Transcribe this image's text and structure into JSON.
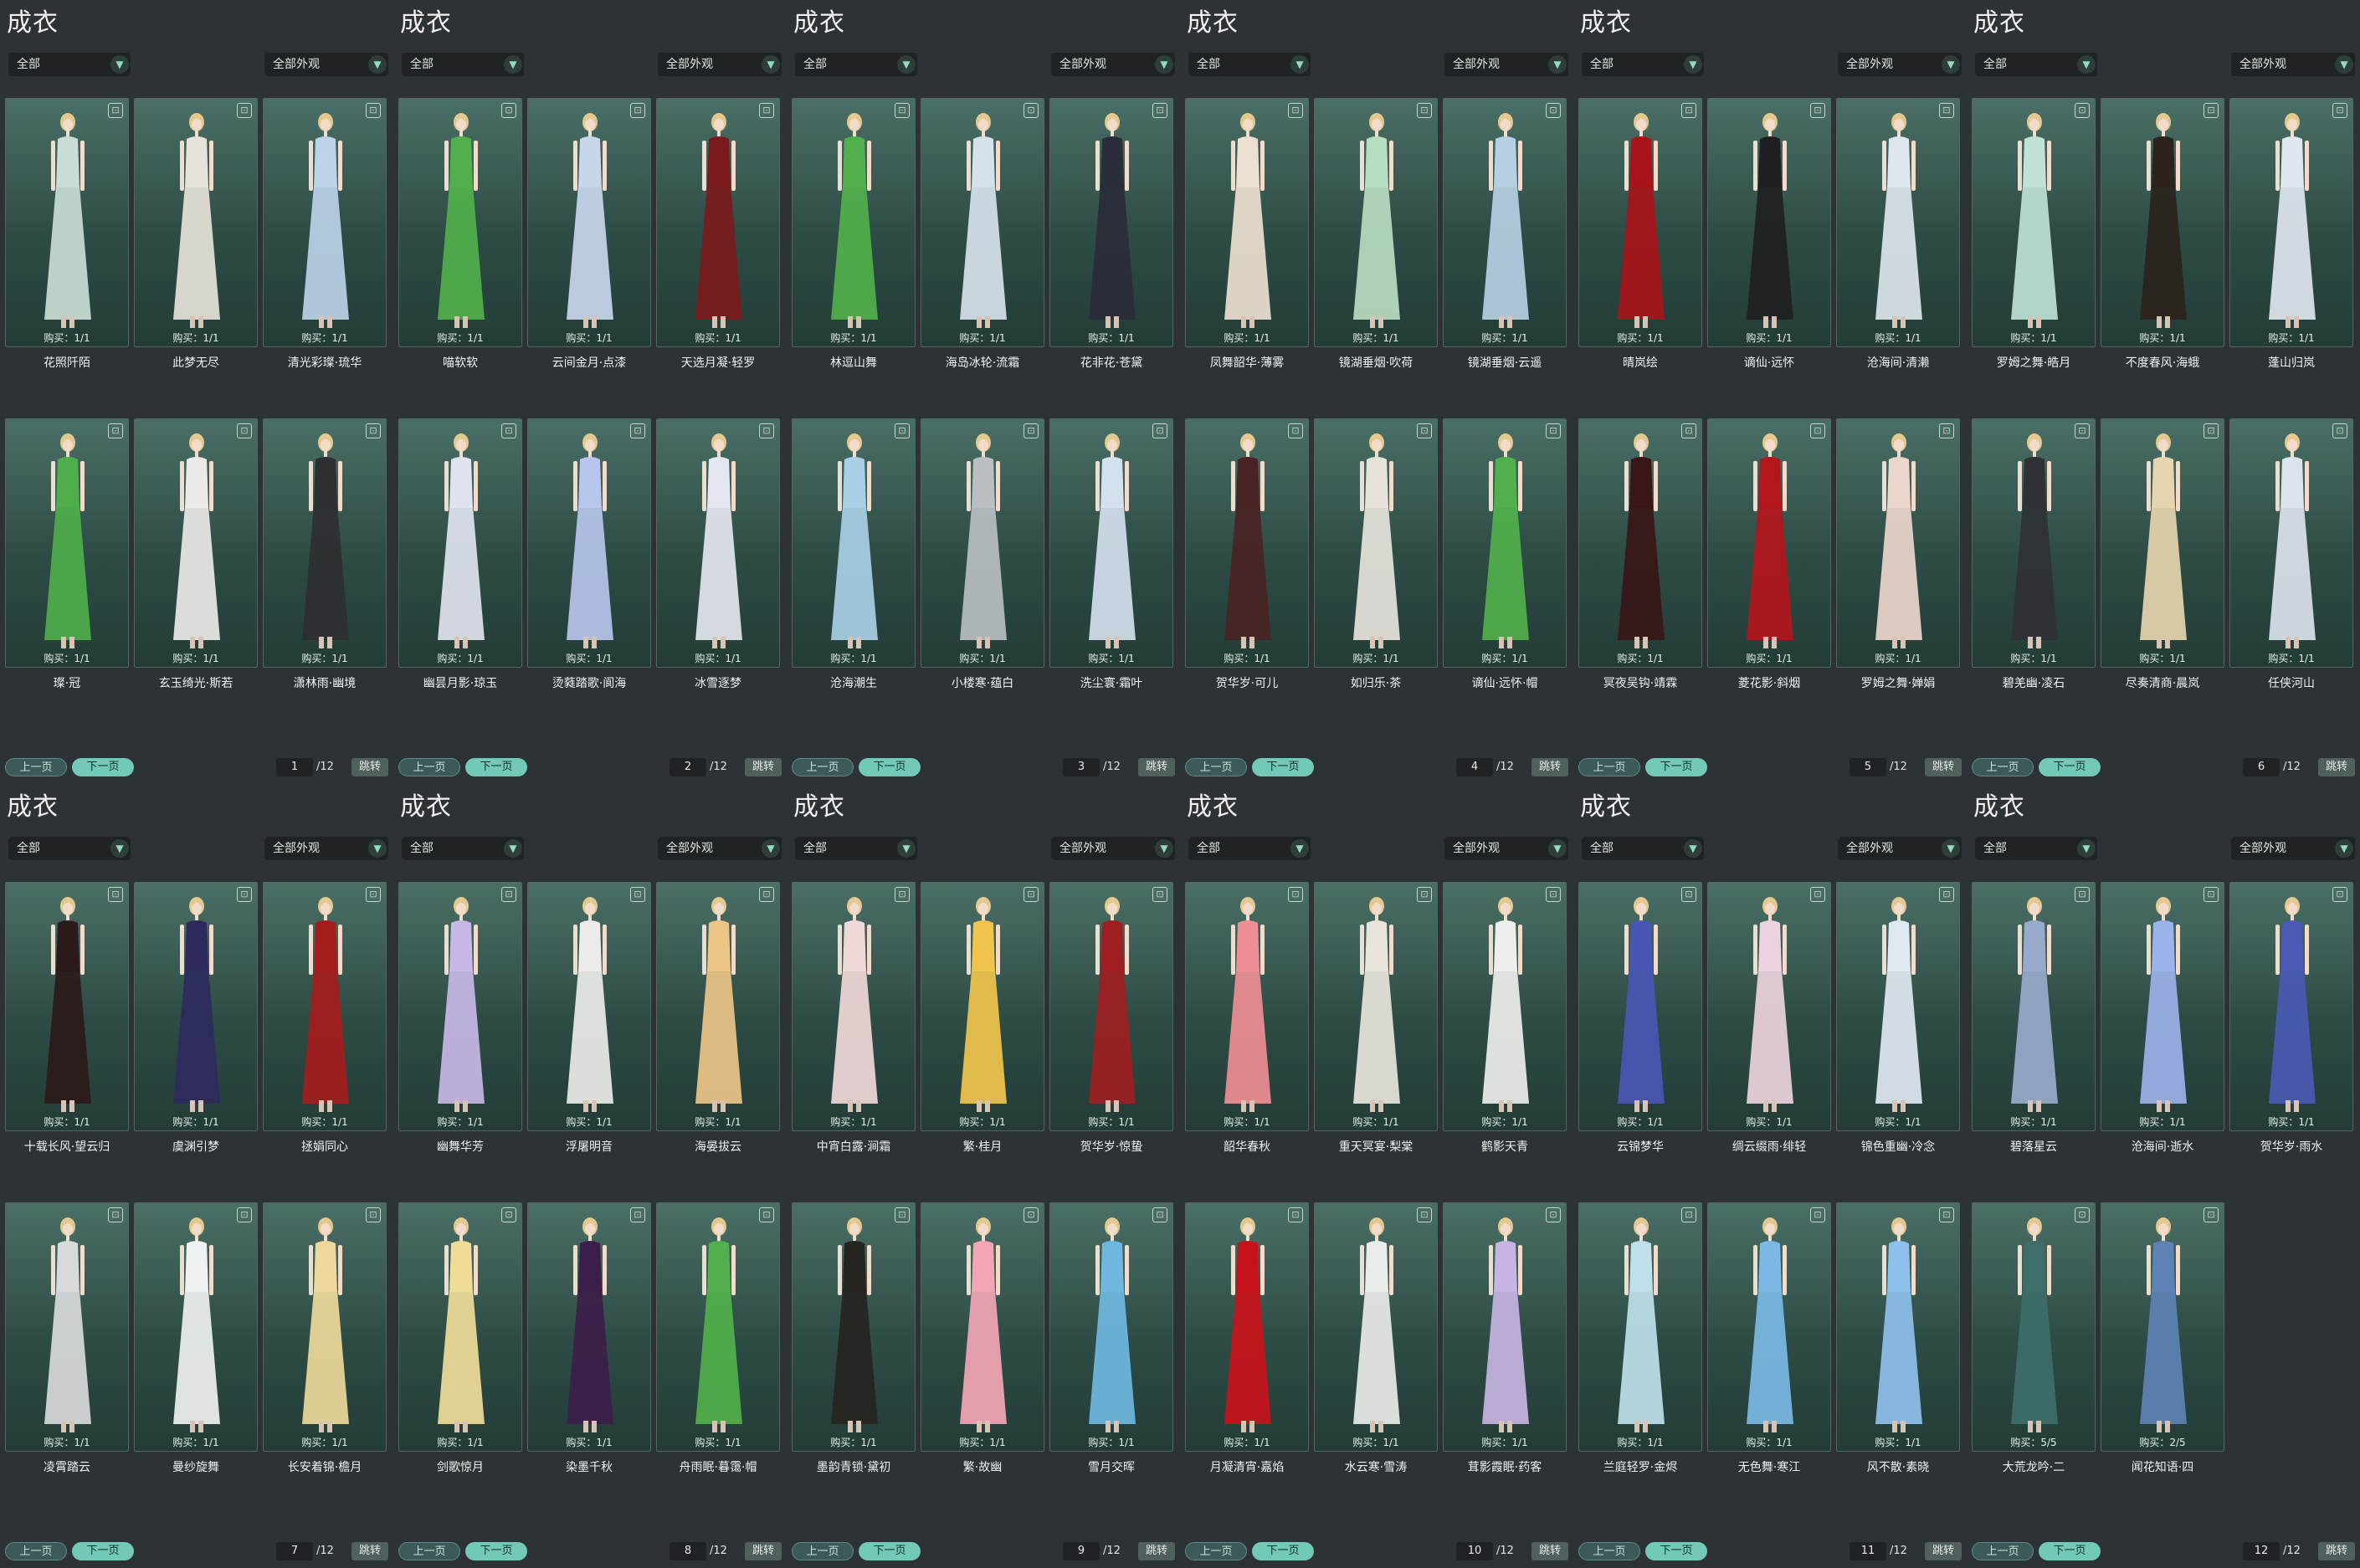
{
  "app": {
    "title": "成衣",
    "filter_all": "全部",
    "filter_appearance": "全部外观",
    "prev_label": "上一页",
    "next_label": "下一页",
    "jump_label": "跳转",
    "total_pages": "/12",
    "dropdown_icon": "chevron-down-icon",
    "corner_icon": "trash-icon",
    "colors": {
      "accent": "#72c9b6",
      "card_top": "#4a6f67",
      "card_bottom": "#233c38",
      "background": "#2b3034"
    }
  },
  "panels": [
    {
      "page": "1",
      "items": [
        {
          "name": "花照阡陌",
          "buy": "购买：1/1",
          "outfit": "#c9ddd5"
        },
        {
          "name": "此梦无尽",
          "buy": "购买：1/1",
          "outfit": "#e6e2d8"
        },
        {
          "name": "清光彩璨·琉华",
          "buy": "购买：1/1",
          "outfit": "#bcd2e8"
        },
        {
          "name": "璨·冠",
          "buy": "购买：1/1",
          "outfit": "#4fae4c"
        },
        {
          "name": "玄玉绮光·斯若",
          "buy": "购买：1/1",
          "outfit": "#ece9e6"
        },
        {
          "name": "潇林雨·幽境",
          "buy": "购买：1/1",
          "outfit": "#2e2f33"
        }
      ]
    },
    {
      "page": "2",
      "items": [
        {
          "name": "喵软软",
          "buy": "购买：1/1",
          "outfit": "#52b04c"
        },
        {
          "name": "云间金月·点漆",
          "buy": "购买：1/1",
          "outfit": "#c8d6ec"
        },
        {
          "name": "天选月凝·轻罗",
          "buy": "购买：1/1",
          "outfit": "#7a1a1c"
        },
        {
          "name": "幽昙月影·琼玉",
          "buy": "购买：1/1",
          "outfit": "#dfe3ee"
        },
        {
          "name": "烫蕤踏歌·阆海",
          "buy": "购买：1/1",
          "outfit": "#b7c6ea"
        },
        {
          "name": "冰雪逐梦",
          "buy": "购买：1/1",
          "outfit": "#e4e7ef"
        }
      ]
    },
    {
      "page": "3",
      "items": [
        {
          "name": "林逗山舞",
          "buy": "购买：1/1",
          "outfit": "#52b04c"
        },
        {
          "name": "海岛冰轮·流霜",
          "buy": "购买：1/1",
          "outfit": "#d6e2ea"
        },
        {
          "name": "花非花·苍黛",
          "buy": "购买：1/1",
          "outfit": "#2a2d3a"
        },
        {
          "name": "沧海潮生",
          "buy": "购买：1/1",
          "outfit": "#a9cfe6"
        },
        {
          "name": "小楼寒·蕴白",
          "buy": "购买：1/1",
          "outfit": "#b9bec2"
        },
        {
          "name": "洗尘寰·霜叶",
          "buy": "购买：1/1",
          "outfit": "#d3e0ee"
        }
      ]
    },
    {
      "page": "4",
      "items": [
        {
          "name": "凤舞韶华·薄雾",
          "buy": "购买：1/1",
          "outfit": "#ecdfd0"
        },
        {
          "name": "镜湖垂烟·吹荷",
          "buy": "购买：1/1",
          "outfit": "#b8dcc0"
        },
        {
          "name": "镜湖垂烟·云遥",
          "buy": "购买：1/1",
          "outfit": "#b6cfe4"
        },
        {
          "name": "贺华岁·可儿",
          "buy": "购买：1/1",
          "outfit": "#4a2424"
        },
        {
          "name": "如归乐·茶",
          "buy": "购买：1/1",
          "outfit": "#e7e3dc"
        },
        {
          "name": "谪仙·远怀·帽",
          "buy": "购买：1/1",
          "outfit": "#52b04c"
        }
      ]
    },
    {
      "page": "5",
      "items": [
        {
          "name": "晴岚绘",
          "buy": "购买：1/1",
          "outfit": "#a8141a"
        },
        {
          "name": "谪仙·远怀",
          "buy": "购买：1/1",
          "outfit": "#1f1f22"
        },
        {
          "name": "沧海间·清濑",
          "buy": "购买：1/1",
          "outfit": "#dce6ec"
        },
        {
          "name": "冥夜吴钩·靖霖",
          "buy": "购买：1/1",
          "outfit": "#3a1616"
        },
        {
          "name": "菱花影·斜烟",
          "buy": "购买：1/1",
          "outfit": "#b3161c"
        },
        {
          "name": "罗姆之舞·婵娟",
          "buy": "购买：1/1",
          "outfit": "#ecd6cc"
        }
      ]
    },
    {
      "page": "6",
      "items": [
        {
          "name": "罗姆之舞·皓月",
          "buy": "购买：1/1",
          "outfit": "#bfe1d6"
        },
        {
          "name": "不度春风·海蛾",
          "buy": "购买：1/1",
          "outfit": "#2b231c"
        },
        {
          "name": "蓬山归岚",
          "buy": "购买：1/1",
          "outfit": "#dfe6ee"
        },
        {
          "name": "碧羌幽·凌石",
          "buy": "购买：1/1",
          "outfit": "#2f3136"
        },
        {
          "name": "尽奏清商·晨岚",
          "buy": "购买：1/1",
          "outfit": "#e6d4ae"
        },
        {
          "name": "任侠河山",
          "buy": "购买：1/1",
          "outfit": "#dbe3ea"
        }
      ]
    },
    {
      "page": "7",
      "items": [
        {
          "name": "十载长风·望云归",
          "buy": "购买：1/1",
          "outfit": "#2c1a1a"
        },
        {
          "name": "虞渊引梦",
          "buy": "购买：1/1",
          "outfit": "#2e2a5e"
        },
        {
          "name": "拯娟同心",
          "buy": "购买：1/1",
          "outfit": "#a51c1c"
        },
        {
          "name": "凌霄踏云",
          "buy": "购买：1/1",
          "outfit": "#d7d9dc"
        },
        {
          "name": "曼纱旋舞",
          "buy": "购买：1/1",
          "outfit": "#eef0f1"
        },
        {
          "name": "长安着锦·檐月",
          "buy": "购买：1/1",
          "outfit": "#eed99a"
        }
      ]
    },
    {
      "page": "8",
      "items": [
        {
          "name": "幽舞华芳",
          "buy": "购买：1/1",
          "outfit": "#c8b8e6"
        },
        {
          "name": "浮屠明音",
          "buy": "购买：1/1",
          "outfit": "#ecebe8"
        },
        {
          "name": "海晏拔云",
          "buy": "购买：1/1",
          "outfit": "#ecc486"
        },
        {
          "name": "剑歌惊月",
          "buy": "购买：1/1",
          "outfit": "#f0dc98"
        },
        {
          "name": "染墨千秋",
          "buy": "购买：1/1",
          "outfit": "#3c1e4a"
        },
        {
          "name": "舟雨眠·暮霭·帽",
          "buy": "购买：1/1",
          "outfit": "#52b04c"
        }
      ]
    },
    {
      "page": "9",
      "items": [
        {
          "name": "中宵白露·涧霜",
          "buy": "购买：1/1",
          "outfit": "#f0d8d8"
        },
        {
          "name": "繁·桂月",
          "buy": "购买：1/1",
          "outfit": "#f0c44c"
        },
        {
          "name": "贺华岁·惊蛰",
          "buy": "购买：1/1",
          "outfit": "#9e1e22"
        },
        {
          "name": "墨韵青锁·黛初",
          "buy": "购买：1/1",
          "outfit": "#26241f"
        },
        {
          "name": "繁·故幽",
          "buy": "购买：1/1",
          "outfit": "#f2a6b4"
        },
        {
          "name": "雪月交晖",
          "buy": "购买：1/1",
          "outfit": "#6eb8e0"
        }
      ]
    },
    {
      "page": "10",
      "items": [
        {
          "name": "韶华春秋",
          "buy": "购买：1/1",
          "outfit": "#ee8e94"
        },
        {
          "name": "重天冥宴·梨棠",
          "buy": "购买：1/1",
          "outfit": "#e8e4dc"
        },
        {
          "name": "鹤影天青",
          "buy": "购买：1/1",
          "outfit": "#eeeeec"
        },
        {
          "name": "月凝清宵·嘉焰",
          "buy": "购买：1/1",
          "outfit": "#c8121a"
        },
        {
          "name": "水云寒·雪涛",
          "buy": "购买：1/1",
          "outfit": "#e9ece8"
        },
        {
          "name": "茸影霞眠·药客",
          "buy": "购买：1/1",
          "outfit": "#c7b4e2"
        }
      ]
    },
    {
      "page": "11",
      "items": [
        {
          "name": "云锦梦华",
          "buy": "购买：1/1",
          "outfit": "#4a56b4"
        },
        {
          "name": "绸云缀雨·绯轻",
          "buy": "购买：1/1",
          "outfit": "#ecd2e0"
        },
        {
          "name": "锦色重幽·冷念",
          "buy": "购买：1/1",
          "outfit": "#dfe8f0"
        },
        {
          "name": "兰庭轻罗·金烬",
          "buy": "购买：1/1",
          "outfit": "#bfe0ea"
        },
        {
          "name": "无色舞·寒江",
          "buy": "购买：1/1",
          "outfit": "#7bb8e4"
        },
        {
          "name": "风不散·素晓",
          "buy": "购买：1/1",
          "outfit": "#8ec0ec"
        }
      ]
    },
    {
      "page": "12",
      "items": [
        {
          "name": "碧落星云",
          "buy": "购买：1/1",
          "outfit": "#98aacb"
        },
        {
          "name": "沧海间·逝水",
          "buy": "购买：1/1",
          "outfit": "#9cb2ea"
        },
        {
          "name": "贺华岁·雨水",
          "buy": "购买：1/1",
          "outfit": "#4a5ab4"
        },
        {
          "name": "大荒龙吟·二",
          "buy": "购买：5/5",
          "outfit": "#3e6e6a"
        },
        {
          "name": "闻花知语·四",
          "buy": "购买：2/5",
          "outfit": "#5e82b4"
        }
      ]
    }
  ]
}
